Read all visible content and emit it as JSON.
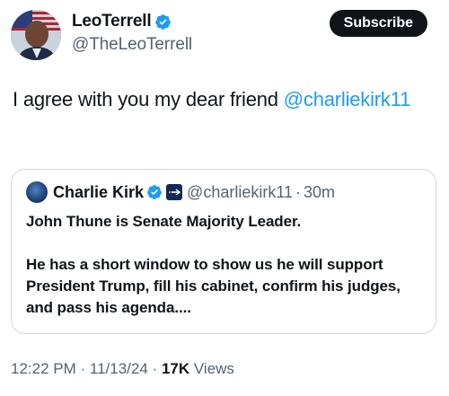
{
  "author": {
    "name": "LeoTerrell",
    "handle": "@TheLeoTerrell"
  },
  "subscribe_label": "Subscribe",
  "tweet": {
    "text_before": "I agree with you my dear friend ",
    "mention": "@charliekirk11"
  },
  "quoted": {
    "name": "Charlie Kirk",
    "handle": "@charliekirk11",
    "separator": "·",
    "time": "30m",
    "paragraphs": [
      "John Thune is Senate Majority Leader.",
      "He has a short window to show us he will support President Trump, fill his cabinet, confirm his judges, and pass his agenda...."
    ]
  },
  "meta": {
    "time": "12:22 PM",
    "separator": "·",
    "date": "11/13/24",
    "views_count": "17K",
    "views_label": "Views"
  },
  "colors": {
    "link": "#1d9bf0",
    "verified": "#1d9bf0",
    "secondary_text": "#536471",
    "border": "#cfd9de"
  },
  "icons": [
    "verified-badge-icon",
    "affiliate-badge-icon",
    "avatar-flag"
  ]
}
